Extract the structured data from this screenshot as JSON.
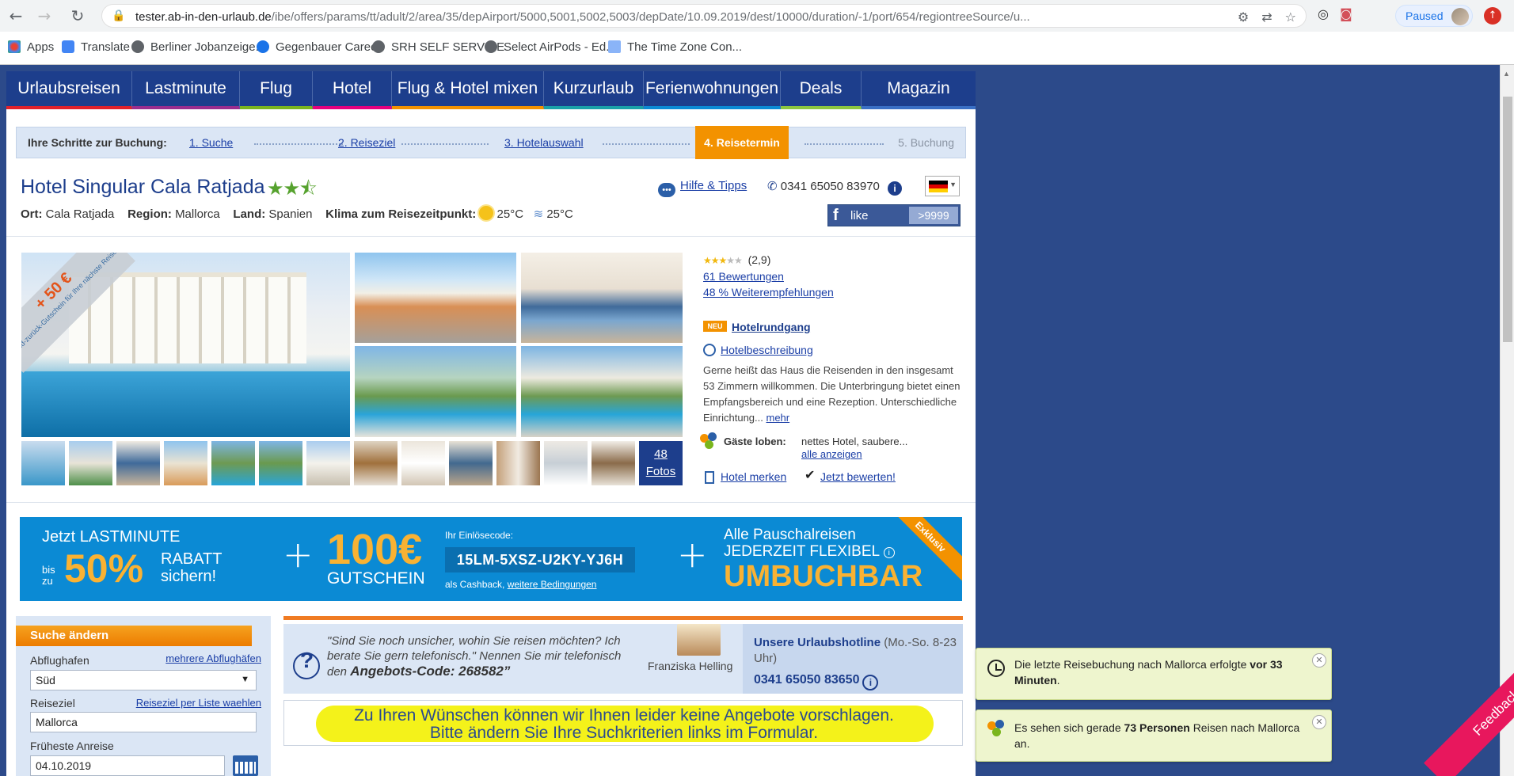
{
  "browser": {
    "url_host": "tester.ab-in-den-urlaub.de",
    "url_path": "/ibe/offers/params/tt/adult/2/area/35/depAirport/5000,5001,5002,5003/depDate/10.09.2019/dest/10000/duration/-1/port/654/regiontreeSource/u...",
    "paused_label": "Paused",
    "bookmarks": [
      "Apps",
      "Translate",
      "Berliner Jobanzeige...",
      "Gegenbauer Career",
      "SRH SELF SERVICE",
      "Select AirPods - Ed...",
      "The Time Zone Con..."
    ]
  },
  "nav": {
    "items": [
      "Urlaubsreisen",
      "Lastminute",
      "Flug",
      "Hotel",
      "Flug & Hotel mixen",
      "Kurzurlaub",
      "Ferienwohnungen",
      "Deals",
      "Magazin"
    ],
    "underline_colors": [
      "#e0212b",
      "#9b2d8e",
      "#7ab51d",
      "#e6007e",
      "#f39200",
      "#1aa1a8",
      "#0b8ad4",
      "#8cc63f",
      "#3a6fc4"
    ]
  },
  "steps": {
    "label": "Ihre Schritte zur Buchung:",
    "step1": "1. Suche",
    "step2": "2. Reiseziel",
    "step3": "3. Hotelauswahl",
    "step4": "4. Reisetermin",
    "step5": "5. Buchung"
  },
  "hotel": {
    "name": "Hotel Singular Cala Ratjada",
    "stars": "★★⯪",
    "ort_label": "Ort:",
    "ort": "Cala Ratjada",
    "region_label": "Region:",
    "region": "Mallorca",
    "land_label": "Land:",
    "land": "Spanien",
    "klima_label": "Klima zum Reisezeitpunkt:",
    "air_temp": "25°C",
    "water_temp": "25°C"
  },
  "header_right": {
    "help": "Hilfe & Tipps",
    "phone": "0341 65050 83970",
    "like": "like",
    "like_count": ">9999"
  },
  "gallery": {
    "ribbon_amount": "+ 50 €",
    "ribbon_text": "Geld-zurück-Gutschein für Ihre nächste Reise",
    "more_count": "48",
    "more_label": "Fotos"
  },
  "reviews": {
    "score": "(2,9)",
    "count_link": "61 Bewertungen",
    "recommend_link": "48 % Weiterempfehlungen",
    "neu": "NEU",
    "rundgang": "Hotelrundgang",
    "beschreibung": "Hotelbeschreibung",
    "desc": "Gerne heißt das Haus die Reisenden in den insgesamt 53 Zimmern willkommen. Die Unterbringung bietet einen Empfangsbereich und eine Rezeption. Unterschiedliche Einrichtung...",
    "mehr": "mehr",
    "guests_label": "Gäste loben:",
    "guests_text": "nettes Hotel, saubere...",
    "guests_all": "alle anzeigen",
    "merken": "Hotel merken",
    "bewerten": "Jetzt bewerten!"
  },
  "banner": {
    "line1": "Jetzt LASTMINUTE",
    "bis": "bis",
    "zu": "zu",
    "percent": "50%",
    "rabatt1": "RABATT",
    "rabatt2": "sichern!",
    "amount": "100€",
    "gutschein": "GUTSCHEIN",
    "code_label": "Ihr Einlösecode:",
    "code": "15LM-5XSZ-U2KY-YJ6H",
    "cashback": "als Cashback,",
    "conditions": "weitere Bedingungen",
    "right1": "Alle Pauschalreisen",
    "right2": "JEDERZEIT FLEXIBEL",
    "umbuchbar": "UMBUCHBAR",
    "exklusiv": "Exklusiv"
  },
  "search": {
    "header": "Suche ändern",
    "abflug_label": "Abflughafen",
    "abflug_link": "mehrere Abflughäfen",
    "abflug_value": "Süd",
    "ziel_label": "Reiseziel",
    "ziel_link": "Reiseziel per Liste waehlen",
    "ziel_value": "Mallorca",
    "anreise_label": "Früheste Anreise",
    "anreise_value": "04.10.2019"
  },
  "hotline": {
    "quote1": "\"Sind Sie noch unsicher, wohin Sie reisen möchten? Ich berate Sie gern telefonisch.\" Nennen Sie mir telefonisch den",
    "code": "Angebots-Code: 268582”",
    "agent": "Franziska Helling",
    "title": "Unsere Urlaubshotline",
    "hours": "(Mo.-So. 8-23 Uhr)",
    "number": "0341 65050 83650"
  },
  "notice": {
    "line1": "Zu Ihren Wünschen können wir Ihnen leider keine Angebote vorschlagen.",
    "line2": "Bitte ändern Sie Ihre Suchkriterien links im Formular."
  },
  "toasts": {
    "t1_a": "Die letzte Reisebuchung nach Mallorca erfolgte",
    "t1_b": "vor 33 Minuten",
    "t1_c": ".",
    "t2_a": "Es sehen sich gerade",
    "t2_b": "73 Personen",
    "t2_c": "Reisen nach Mallorca an."
  },
  "feedback": "Feedback"
}
